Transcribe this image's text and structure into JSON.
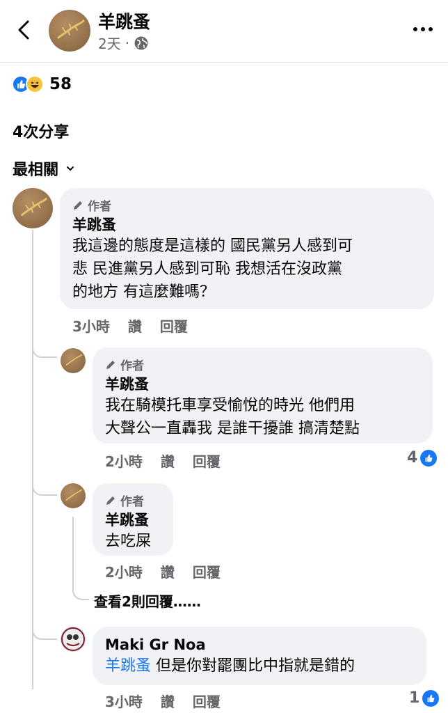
{
  "header": {
    "name": "羊跳蚤",
    "time": "2天",
    "separator": "·"
  },
  "reactions": {
    "count": "58",
    "types": [
      "like-icon",
      "haha-icon"
    ]
  },
  "shares": "4次分享",
  "sort": {
    "label": "最相關"
  },
  "comments": [
    {
      "badge": "作者",
      "name": "羊跳蚤",
      "lines": [
        "我這邊的態度是這樣的 國民黨另人感到可",
        "悲 民進黨另人感到可恥 我想活在沒政黨",
        "的地方 有這麼難嗎？"
      ],
      "time": "3小時",
      "like": "讚",
      "reply": "回覆"
    },
    {
      "badge": "作者",
      "name": "羊跳蚤",
      "lines": [
        "我在騎模托車享受愉悅的時光 他們用",
        "大聲公一直轟我 是誰干擾誰 搞清楚點"
      ],
      "time": "2小時",
      "like": "讚",
      "reply": "回覆",
      "likes": "4"
    },
    {
      "badge": "作者",
      "name": "羊跳蚤",
      "lines": [
        "去吃屎"
      ],
      "time": "2小時",
      "like": "讚",
      "reply": "回覆"
    },
    {
      "name": "Maki Gr Noa",
      "mention": "羊跳蚤",
      "text": " 但是你對罷團比中指就是錯的",
      "time": "3小時",
      "like": "讚",
      "reply": "回覆",
      "likes": "1"
    }
  ],
  "view_more": "查看2則回覆……",
  "colors": {
    "accent": "#1877f2",
    "bubble": "#f0f2f5",
    "secondary_text": "#65676b"
  }
}
